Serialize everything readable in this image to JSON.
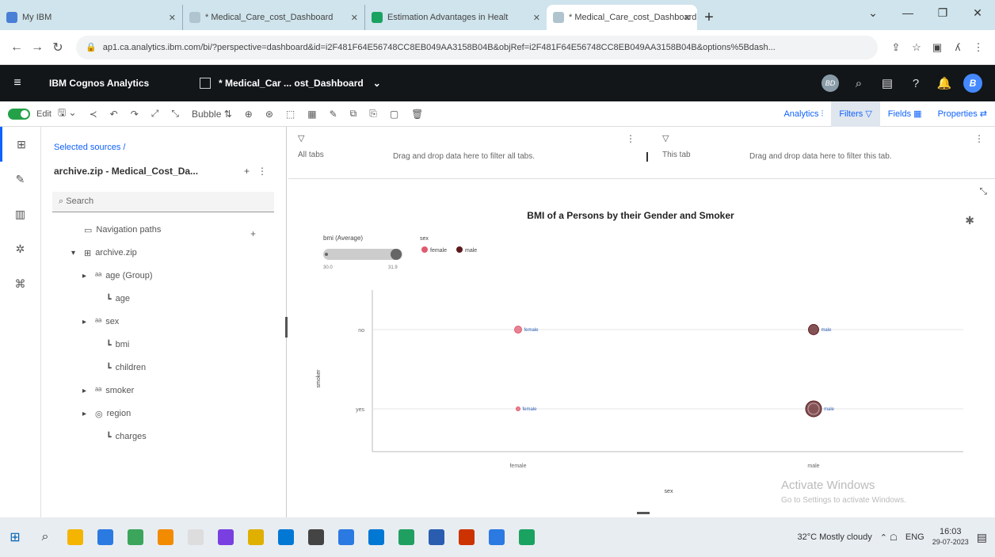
{
  "browser": {
    "tabs": [
      {
        "title": "My IBM",
        "icon_color": "#4a7fd6",
        "active": false
      },
      {
        "title": "* Medical_Care_cost_Dashboard",
        "icon_color": "#b0c4d0",
        "active": false
      },
      {
        "title": "Estimation Advantages in Healt",
        "icon_color": "#1aa260",
        "active": false
      },
      {
        "title": "* Medical_Care_cost_Dashboard",
        "icon_color": "#b0c4d0",
        "active": true
      }
    ],
    "new_tab": "+",
    "url": "ap1.ca.analytics.ibm.com/bi/?perspective=dashboard&id=i2F481F64E56748CC8EB049AA3158B04B&objRef=i2F481F64E56748CC8EB049AA3158B04B&options%5Bdash..."
  },
  "app": {
    "brand": "IBM Cognos Analytics",
    "dashboard_title": "* Medical_Car ... ost_Dashboard",
    "avatar_badge": "BD",
    "user_initial": "B"
  },
  "toolbar": {
    "edit_label": "Edit",
    "bubble_label": "Bubble",
    "analytics_label": "Analytics",
    "filters_label": "Filters",
    "fields_label": "Fields",
    "properties_label": "Properties"
  },
  "source_panel": {
    "selected_sources": "Selected sources  /",
    "source_name": "archive.zip - Medical_Cost_Da...",
    "search_placeholder": "Search",
    "tree": [
      {
        "label": "Navigation paths",
        "glyph": "",
        "icon": "▭",
        "level": 1
      },
      {
        "label": "archive.zip",
        "glyph": "▾",
        "icon": "⊞",
        "level": 1
      },
      {
        "label": "age (Group)",
        "glyph": "▸",
        "icon": "ᵃᵃ",
        "level": 2
      },
      {
        "label": "age",
        "glyph": "",
        "icon": "┗",
        "level": 3
      },
      {
        "label": "sex",
        "glyph": "▸",
        "icon": "ᵃᵃ",
        "level": 2
      },
      {
        "label": "bmi",
        "glyph": "",
        "icon": "┗",
        "level": 3
      },
      {
        "label": "children",
        "glyph": "",
        "icon": "┗",
        "level": 3
      },
      {
        "label": "smoker",
        "glyph": "▸",
        "icon": "ᵃᵃ",
        "level": 2
      },
      {
        "label": "region",
        "glyph": "▸",
        "icon": "◎",
        "level": 2
      },
      {
        "label": "charges",
        "glyph": "",
        "icon": "┗",
        "level": 3
      }
    ]
  },
  "filters": {
    "all_tabs_label": "All tabs",
    "all_tabs_hint": "Drag and drop data here to filter all tabs.",
    "this_tab_label": "This tab",
    "this_tab_hint": "Drag and drop data here to filter this tab."
  },
  "chart_data": {
    "type": "scatter",
    "title": "BMI of a Persons by their Gender and Smoker",
    "xlabel": "sex",
    "ylabel": "smoker",
    "x_categories": [
      "female",
      "male"
    ],
    "y_categories": [
      "no",
      "yes"
    ],
    "size_legend": {
      "title": "bmi (Average)",
      "min_label": "30.0",
      "max_label": "31.9"
    },
    "color_legend": {
      "title": "sex",
      "items": [
        {
          "name": "female",
          "color": "#e05b6f"
        },
        {
          "name": "male",
          "color": "#5c1a1e"
        }
      ]
    },
    "points": [
      {
        "x": "female",
        "y": "no",
        "label": "female",
        "bmi": 30.5,
        "color": "#e05b6f"
      },
      {
        "x": "male",
        "y": "no",
        "label": "male",
        "bmi": 31.0,
        "color": "#5c1a1e"
      },
      {
        "x": "female",
        "y": "yes",
        "label": "female",
        "bmi": 30.0,
        "color": "#e05b6f"
      },
      {
        "x": "male",
        "y": "yes",
        "label": "male",
        "bmi": 31.9,
        "color": "#5c1a1e"
      }
    ],
    "grid": true
  },
  "watermark": {
    "line1": "Activate Windows",
    "line2": "Go to Settings to activate Windows."
  },
  "taskbar": {
    "icons": [
      "#f4b400",
      "#2a7ae2",
      "#3ba55c",
      "#f28b00",
      "#dddddd",
      "#7a3fe0",
      "#e0b000",
      "#0078d4",
      "#444",
      "#2a7ae2",
      "#0078d4",
      "#20a060",
      "#2a5db0",
      "#cc3300",
      "#2a7ae2",
      "#1aa260"
    ],
    "weather": "32°C  Mostly cloudy",
    "lang": "ENG",
    "time": "16:03",
    "date": "29-07-2023"
  }
}
